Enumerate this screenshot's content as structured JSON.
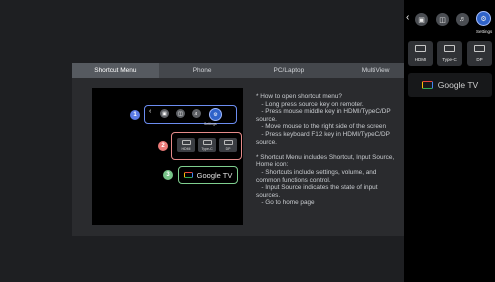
{
  "tabs": [
    {
      "label": "Shortcut Menu"
    },
    {
      "label": "Phone"
    },
    {
      "label": "PC/Laptop"
    },
    {
      "label": "MultiView"
    }
  ],
  "illustration": {
    "callouts": [
      "1",
      "2",
      "3"
    ],
    "callout_colors": [
      "#5b7be6",
      "#ea7a78",
      "#76c387"
    ],
    "settings_label": "Settings",
    "sources": [
      "HDMI",
      "Type-C",
      "DP"
    ],
    "google_tv_label": "Google TV"
  },
  "instructions": [
    "* How to open shortcut menu?",
    "   - Long press source key on remoter.",
    "   - Press mouse middle key in HDMI/TypeC/DP",
    "source.",
    "   - Move mouse to the right side of the screen",
    "   - Press keyboard F12 key in HDMI/TypeC/DP",
    "source.",
    "",
    "* Shortcut Menu includes Shortcut, Input Source,",
    "Home icon:",
    "   - Shortcuts include settings, volume, and",
    "common functions control.",
    "   - Input Source indicates the state of input",
    "sources.",
    "   - Go to home page"
  ],
  "side_panel": {
    "settings_label": "Settings",
    "sources": [
      "HDMI",
      "Type-C",
      "DP"
    ],
    "google_tv_label": "Google TV"
  },
  "icons": {
    "back": "chevron-left-icon",
    "screen_a": "picture-mode-icon",
    "screen_b": "display-icon",
    "volume": "volume-icon",
    "settings": "gear-icon"
  },
  "colors": {
    "accent": "#3a6fd8",
    "settings_active": "#2f63c9"
  }
}
